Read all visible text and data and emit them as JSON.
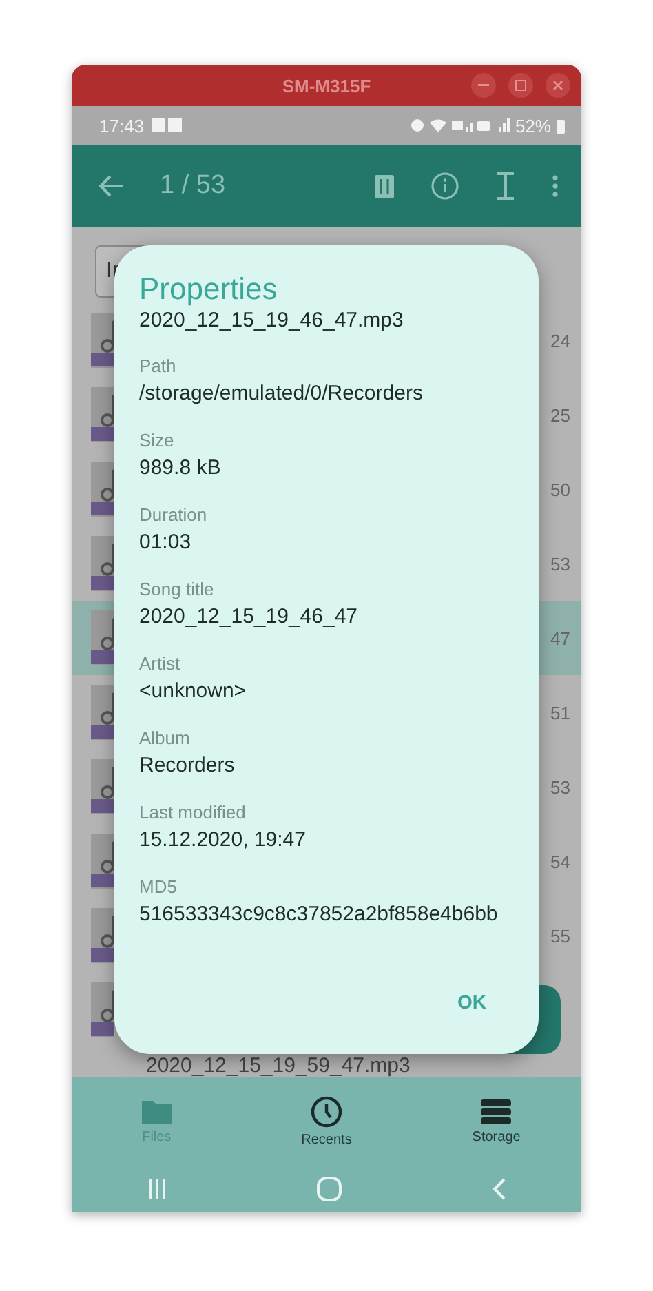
{
  "window": {
    "title": "SM-M315F"
  },
  "status_bar": {
    "time": "17:43",
    "battery": "52%"
  },
  "app_bar": {
    "counter": "1 / 53"
  },
  "file_list": {
    "chip": "Ir",
    "rows": [
      {
        "time": "24",
        "selected": false
      },
      {
        "time": "25",
        "selected": false
      },
      {
        "time": "50",
        "selected": false
      },
      {
        "time": "53",
        "selected": false
      },
      {
        "time": "47",
        "selected": true
      },
      {
        "time": "51",
        "selected": false
      },
      {
        "time": "53",
        "selected": false
      },
      {
        "time": "54",
        "selected": false
      },
      {
        "time": "55",
        "selected": false
      },
      {
        "selected": false
      }
    ],
    "last_row": {
      "name": "2020_12_15_19_59_47.mp3"
    }
  },
  "dialog": {
    "title": "Properties",
    "filename": "2020_12_15_19_46_47.mp3",
    "fields": [
      {
        "label": "Path",
        "value": "/storage/emulated/0/Recorders"
      },
      {
        "label": "Size",
        "value": "989.8 kB"
      },
      {
        "label": "Duration",
        "value": "01:03"
      },
      {
        "label": "Song title",
        "value": "2020_12_15_19_46_47"
      },
      {
        "label": "Artist",
        "value": "<unknown>"
      },
      {
        "label": "Album",
        "value": "Recorders"
      },
      {
        "label": "Last modified",
        "value": "15.12.2020, 19:47"
      },
      {
        "label": "MD5",
        "value": "516533343c9c8c37852a2bf858e4b6bb"
      }
    ],
    "button": "OK"
  },
  "bottom_nav": [
    {
      "kind": "folder",
      "label": "Files",
      "selected": true
    },
    {
      "kind": "clock",
      "label": "Recents",
      "selected": false
    },
    {
      "kind": "storage",
      "label": "Storage",
      "selected": false
    }
  ]
}
